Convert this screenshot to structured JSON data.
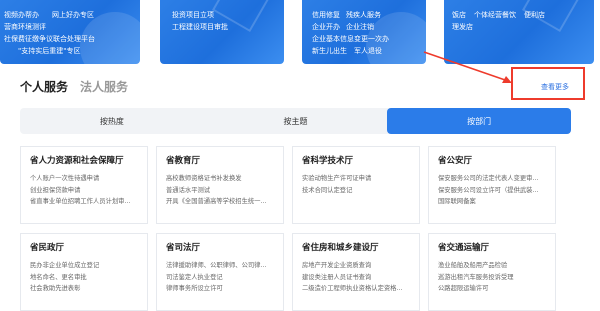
{
  "banners": [
    {
      "links": [
        "视频办帮办",
        "网上好办专区",
        "营商环境测评",
        "社保费征缴争议联合处理平台",
        "\"支持实后重建\"专区"
      ]
    },
    {
      "links": [
        "投资项目立项",
        "工程建设项目审批"
      ]
    },
    {
      "links": [
        "信用修复",
        "残疾人服务",
        "企业开办",
        "企业注销",
        "企业基本信息变更一次办",
        "新生儿出生",
        "军人退役"
      ]
    },
    {
      "links": [
        "饭店",
        "个体经营餐饮",
        "便利店",
        "理发店"
      ]
    }
  ],
  "section_tabs": [
    {
      "label": "个人服务",
      "active": true
    },
    {
      "label": "法人服务",
      "active": false
    }
  ],
  "more_label": "查看更多",
  "filter_tabs": [
    {
      "label": "按热度",
      "active": false
    },
    {
      "label": "按主题",
      "active": false
    },
    {
      "label": "按部门",
      "active": true
    }
  ],
  "departments": [
    {
      "title": "省人力资源和社会保障厅",
      "items": [
        "个人账户一次性待遇申请",
        "创业担保贷款申请",
        "省直事业单位招聘工作人员计划审..."
      ]
    },
    {
      "title": "省教育厅",
      "items": [
        "高校教师资格证书补发换发",
        "普通话水平测试",
        "开具《全国普通高等学校招生统一..."
      ]
    },
    {
      "title": "省科学技术厅",
      "items": [
        "实验动物生产许可证申请",
        "技术合同认定登记"
      ]
    },
    {
      "title": "省公安厅",
      "items": [
        "保安服务公司的法定代表人变更审...",
        "保安服务公司设立许可（提供武装...",
        "国际联网备案"
      ]
    },
    {
      "title": "省民政厅",
      "items": [
        "民办非企业单位成立登记",
        "地名命名、更名审批",
        "社会救助先进表彰"
      ]
    },
    {
      "title": "省司法厅",
      "items": [
        "法律援助律师、公职律师、公司律...",
        "司法鉴定人执业登记",
        "律师事务所设立许可"
      ]
    },
    {
      "title": "省住房和城乡建设厅",
      "items": [
        "房地产开发企业资质查询",
        "建设类注册人员证书查询",
        "二级造价工程师执业资格认定资格..."
      ]
    },
    {
      "title": "省交通运输厅",
      "items": [
        "渔业船舶及船用产品检验",
        "巡游出租汽车服务投诉受理",
        "公路超限运输许可"
      ]
    }
  ]
}
